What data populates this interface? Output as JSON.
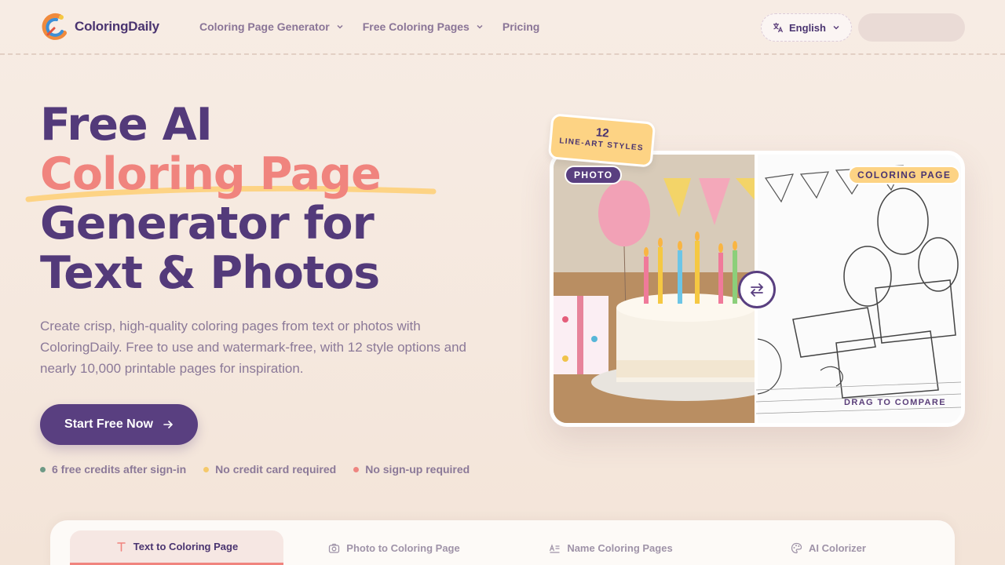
{
  "header": {
    "brand": "ColoringDaily",
    "nav": [
      {
        "label": "Coloring Page Generator",
        "has_dropdown": true
      },
      {
        "label": "Free Coloring Pages",
        "has_dropdown": true
      },
      {
        "label": "Pricing",
        "has_dropdown": false
      }
    ],
    "language": "English"
  },
  "hero": {
    "title_line1": "Free AI",
    "title_accent": "Coloring Page",
    "title_line3": "Generator for",
    "title_line4": "Text & Photos",
    "description": "Create crisp, high-quality coloring pages from text or photos with ColoringDaily. Free to use and watermark-free, with 12 style options and nearly 10,000 printable pages for inspiration.",
    "cta_label": "Start Free Now",
    "perks": [
      {
        "label": "6 free credits after sign-in",
        "color": "#6e9a86"
      },
      {
        "label": "No credit card required",
        "color": "#f5c96a"
      },
      {
        "label": "No sign-up required",
        "color": "#ee8580"
      }
    ]
  },
  "compare": {
    "badge_number": "12",
    "badge_label": "LINE-ART STYLES",
    "photo_tag": "PHOTO",
    "coloring_tag": "COLORING PAGE",
    "drag_hint": "DRAG TO COMPARE"
  },
  "tabs": [
    {
      "label": "Text to Coloring Page",
      "icon": "text-icon",
      "active": true
    },
    {
      "label": "Photo to Coloring Page",
      "icon": "camera-icon",
      "active": false
    },
    {
      "label": "Name Coloring Pages",
      "icon": "name-text-icon",
      "active": false
    },
    {
      "label": "AI Colorizer",
      "icon": "palette-icon",
      "active": false
    }
  ],
  "colors": {
    "brand_purple": "#593f80",
    "accent_coral": "#f0847e",
    "accent_yellow": "#fdd384",
    "background": "#f7ece4"
  }
}
